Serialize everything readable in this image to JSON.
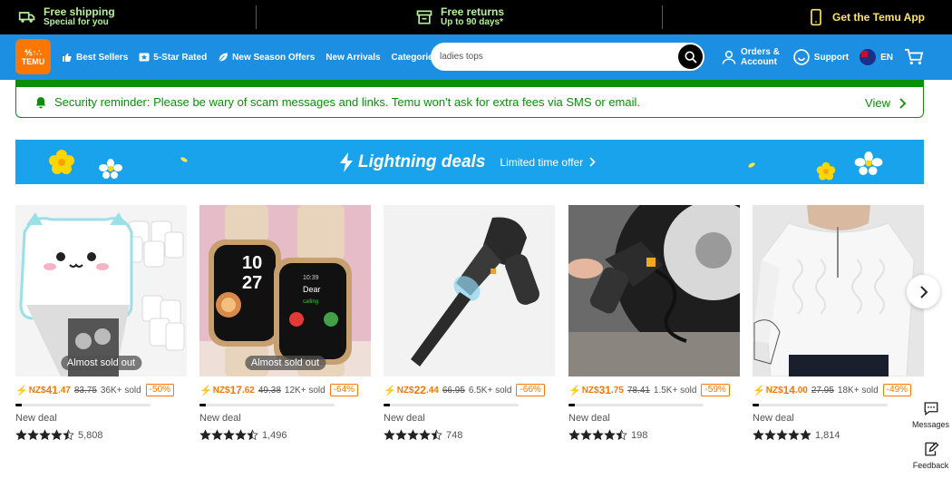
{
  "promo": {
    "shipping_title": "Free shipping",
    "shipping_sub": "Special for you",
    "returns_title": "Free returns",
    "returns_sub": "Up to 90 days*",
    "app_label": "Get the Temu App"
  },
  "header": {
    "logo_text_top": "⅘↑∴",
    "logo_text": "TEMU",
    "nav": [
      {
        "label": "Best Sellers",
        "icon": "thumbs-up-icon"
      },
      {
        "label": "5-Star Rated",
        "icon": "star-box-icon"
      },
      {
        "label": "New Season Offers",
        "icon": "leaf-icon"
      },
      {
        "label": "New Arrivals",
        "icon": ""
      },
      {
        "label": "Categories",
        "icon": "chevron-down-icon"
      }
    ],
    "search_value": "ladies tops",
    "orders_line1": "Orders &",
    "orders_line2": "Account",
    "support": "Support",
    "language": "EN"
  },
  "security": {
    "text": "Security reminder: Please be wary of scam messages and links. Temu won't ask for extra fees via SMS or email.",
    "view": "View"
  },
  "banner": {
    "title": "Lightning deals",
    "subtitle": "Limited time offer"
  },
  "products": [
    {
      "currency": "NZ$",
      "price_int": "41",
      "price_dec": ".47",
      "old_price": "83.75",
      "sold": "36K+ sold",
      "discount": "-50%",
      "progress": 0.05,
      "deal": "New deal",
      "rating": 4.5,
      "reviews": "5,808",
      "badge": "Almost sold out",
      "image": "mini-printer"
    },
    {
      "currency": "NZ$",
      "price_int": "17",
      "price_dec": ".62",
      "old_price": "49.38",
      "sold": "12K+ sold",
      "discount": "-64%",
      "progress": 0.05,
      "deal": "New deal",
      "rating": 4.5,
      "reviews": "1,496",
      "badge": "Almost sold out",
      "image": "smart-watch"
    },
    {
      "currency": "NZ$",
      "price_int": "22",
      "price_dec": ".44",
      "old_price": "66.95",
      "sold": "6.5K+ sold",
      "discount": "-66%",
      "progress": 0.05,
      "deal": "New deal",
      "rating": 4.5,
      "reviews": "748",
      "badge": "",
      "image": "handheld-vacuum"
    },
    {
      "currency": "NZ$",
      "price_int": "31",
      "price_dec": ".75",
      "old_price": "78.41",
      "sold": "1.5K+ sold",
      "discount": "-59%",
      "progress": 0.05,
      "deal": "New deal",
      "rating": 4.5,
      "reviews": "198",
      "badge": "",
      "image": "tire-inflator"
    },
    {
      "currency": "NZ$",
      "price_int": "14",
      "price_dec": ".00",
      "old_price": "27.95",
      "sold": "18K+ sold",
      "discount": "-49%",
      "progress": 0.05,
      "deal": "New deal",
      "rating": 5,
      "reviews": "1,814",
      "badge": "",
      "image": "knit-sweater"
    }
  ],
  "side": {
    "messages": "Messages",
    "feedback": "Feedback"
  },
  "colors": {
    "brand_orange": "#fb7701",
    "header_blue": "#1c8fe3",
    "banner_blue": "#19a3ec",
    "security_green": "#0a8f08"
  }
}
